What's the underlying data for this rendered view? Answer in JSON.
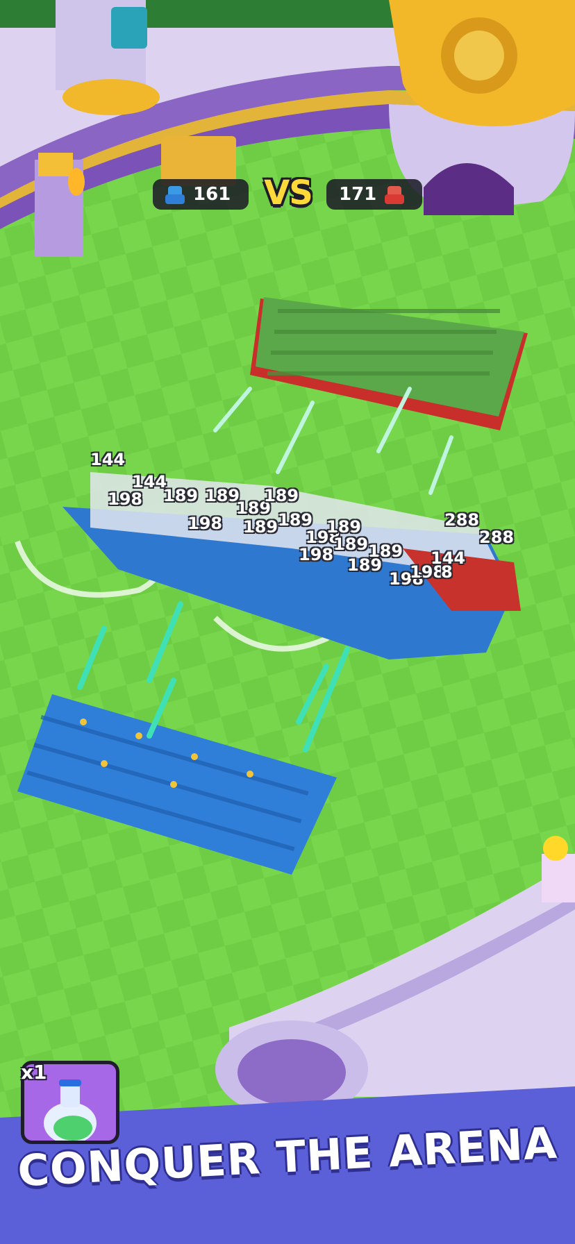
{
  "hud": {
    "blue_count": "161",
    "red_count": "171",
    "vs_label": "VS",
    "blue_icon": "blue-soldier-icon",
    "red_icon": "red-soldier-icon"
  },
  "damage_numbers": [
    "144",
    "144",
    "198",
    "189",
    "189",
    "189",
    "189",
    "198",
    "189",
    "198",
    "189",
    "189",
    "198",
    "288",
    "288",
    "144",
    "189",
    "198",
    "198",
    "189",
    "189",
    "8"
  ],
  "powerup": {
    "count_label": "x1",
    "icon": "potion-bottle-icon"
  },
  "banner": {
    "title": "CONQUER THE ARENA"
  },
  "colors": {
    "grass_light": "#7bd84f",
    "grass_dark": "#6cc944",
    "blue_team": "#2f7fd8",
    "red_team": "#d93a34",
    "banner": "#5b5fd8",
    "vs_yellow": "#ffd93a"
  }
}
